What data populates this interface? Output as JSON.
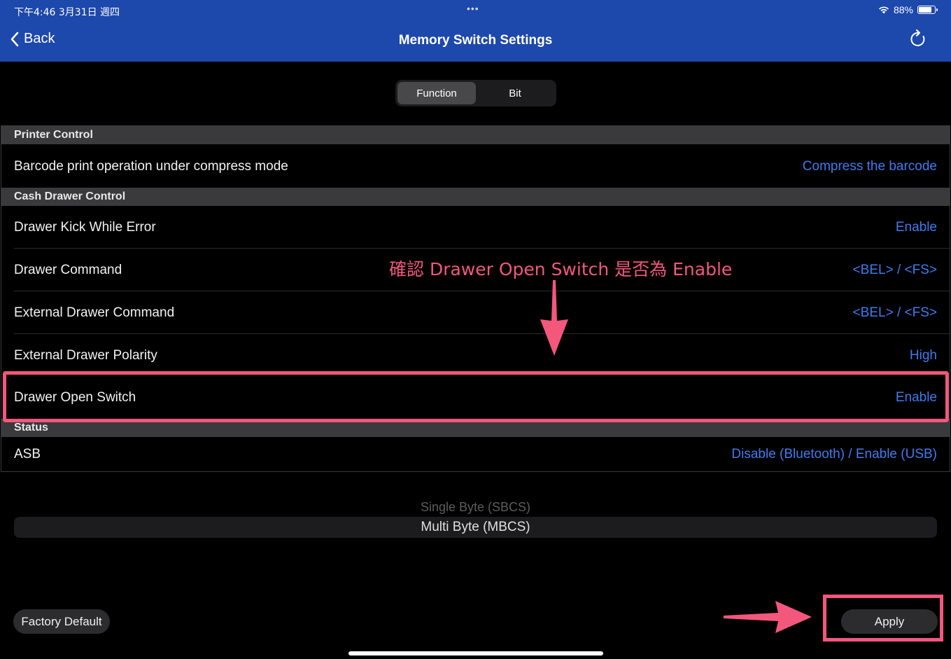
{
  "status_bar": {
    "time_date": "下午4:46   3月31日 週四",
    "dots": "•••",
    "battery_percent": "88%",
    "battery_level": 0.88
  },
  "nav": {
    "back_label": "Back",
    "title": "Memory Switch Settings",
    "back_icon": "chevron-left-icon",
    "refresh_icon": "refresh-icon"
  },
  "segmented": {
    "items": [
      "Function",
      "Bit"
    ],
    "selected": "Function"
  },
  "sections": [
    {
      "header": "Printer Control",
      "rows": [
        {
          "label": "Barcode print operation under compress mode",
          "value": "Compress the barcode"
        }
      ]
    },
    {
      "header": "Cash Drawer Control",
      "rows": [
        {
          "label": "Drawer Kick While Error",
          "value": "Enable"
        },
        {
          "label": "Drawer Command",
          "value": "<BEL> / <FS>"
        },
        {
          "label": "External Drawer Command",
          "value": "<BEL> / <FS>"
        },
        {
          "label": "External Drawer Polarity",
          "value": "High"
        },
        {
          "label": "Drawer Open Switch",
          "value": "Enable"
        }
      ]
    },
    {
      "header": "Status",
      "rows": [
        {
          "label": "ASB",
          "value": "Disable (Bluetooth) / Enable (USB)"
        }
      ]
    }
  ],
  "picker": {
    "options": [
      "Single Byte (SBCS)",
      "Multi Byte (MBCS)"
    ],
    "selected": "Multi Byte (MBCS)"
  },
  "buttons": {
    "factory_default": "Factory Default",
    "apply": "Apply"
  },
  "annotation": {
    "text": "確認 Drawer Open Switch 是否為 Enable",
    "color": "#f3577c"
  },
  "colors": {
    "nav_bar": "#1d48ac",
    "value_link": "#3e7bf0",
    "highlight": "#f3577c"
  }
}
